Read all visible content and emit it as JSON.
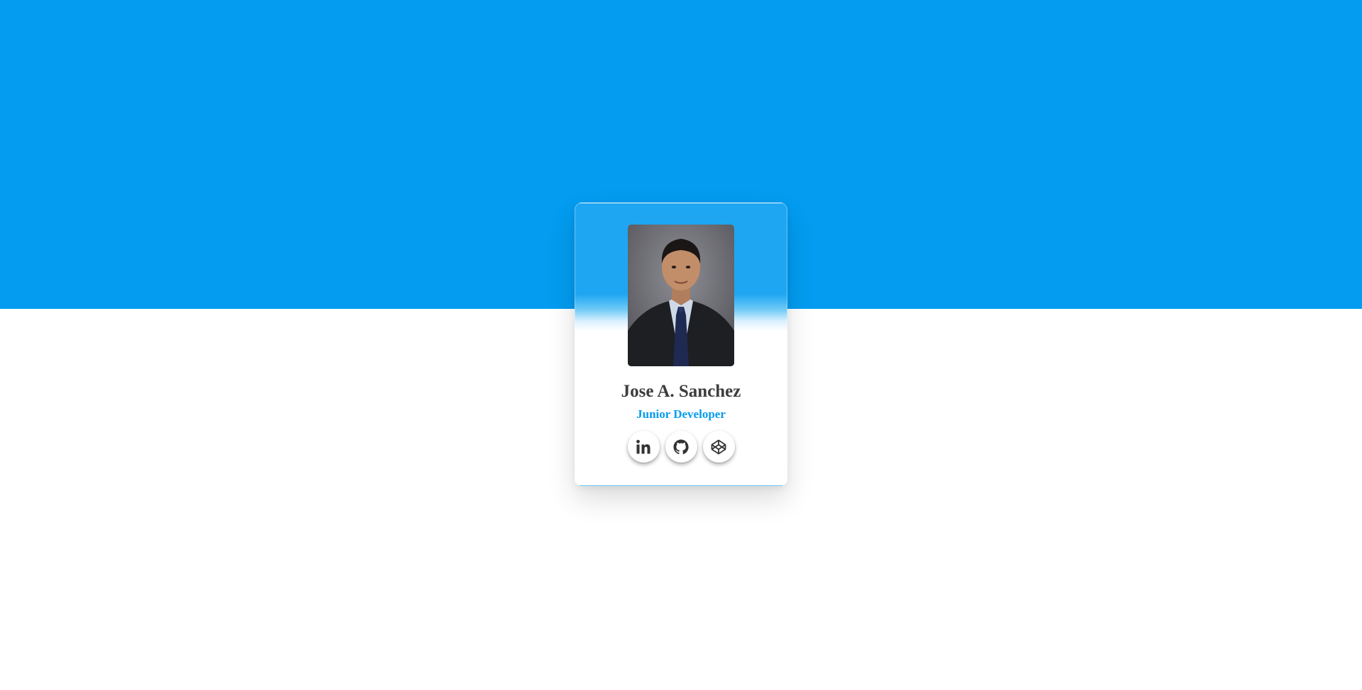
{
  "profile": {
    "name": "Jose A. Sanchez",
    "role": "Junior Developer",
    "photo_icon": "profile-photo"
  },
  "socials": [
    {
      "icon": "linkedin-icon"
    },
    {
      "icon": "github-icon"
    },
    {
      "icon": "codepen-icon"
    }
  ],
  "colors": {
    "brand_blue": "#039cf0",
    "card_top": "#1ea6f2",
    "name_text": "#3d3d3d",
    "icon_dark": "#333333",
    "background": "#ffffff"
  }
}
